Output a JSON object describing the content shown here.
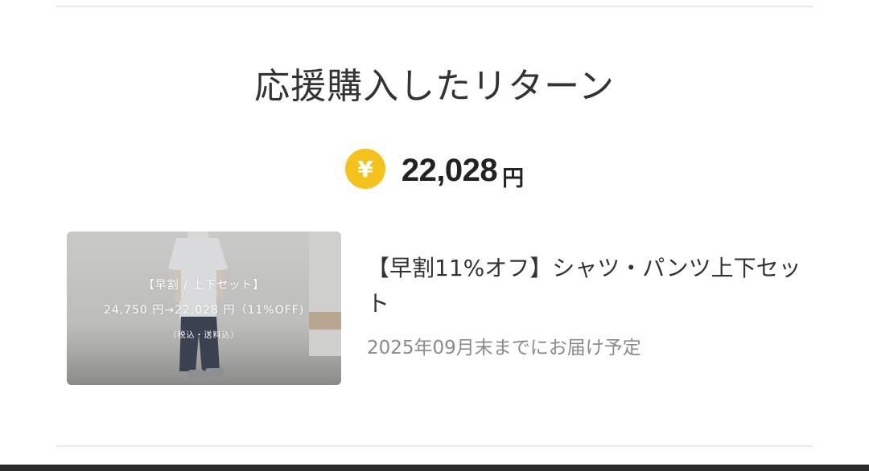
{
  "section": {
    "title": "応援購入したリターン"
  },
  "amount": {
    "icon": "yen-coin-icon",
    "icon_glyph": "¥",
    "icon_color": "#f5c21b",
    "value": "22,028",
    "unit": "円"
  },
  "reward": {
    "image": {
      "line1": "【早割 / 上下セット】",
      "line2": "24,750 円→22,028 円（11%OFF)",
      "line3": "（税込・送料込）"
    },
    "title": "【早割11%オフ】シャツ・パンツ上下セット",
    "delivery": "2025年09月末までにお届け予定"
  }
}
